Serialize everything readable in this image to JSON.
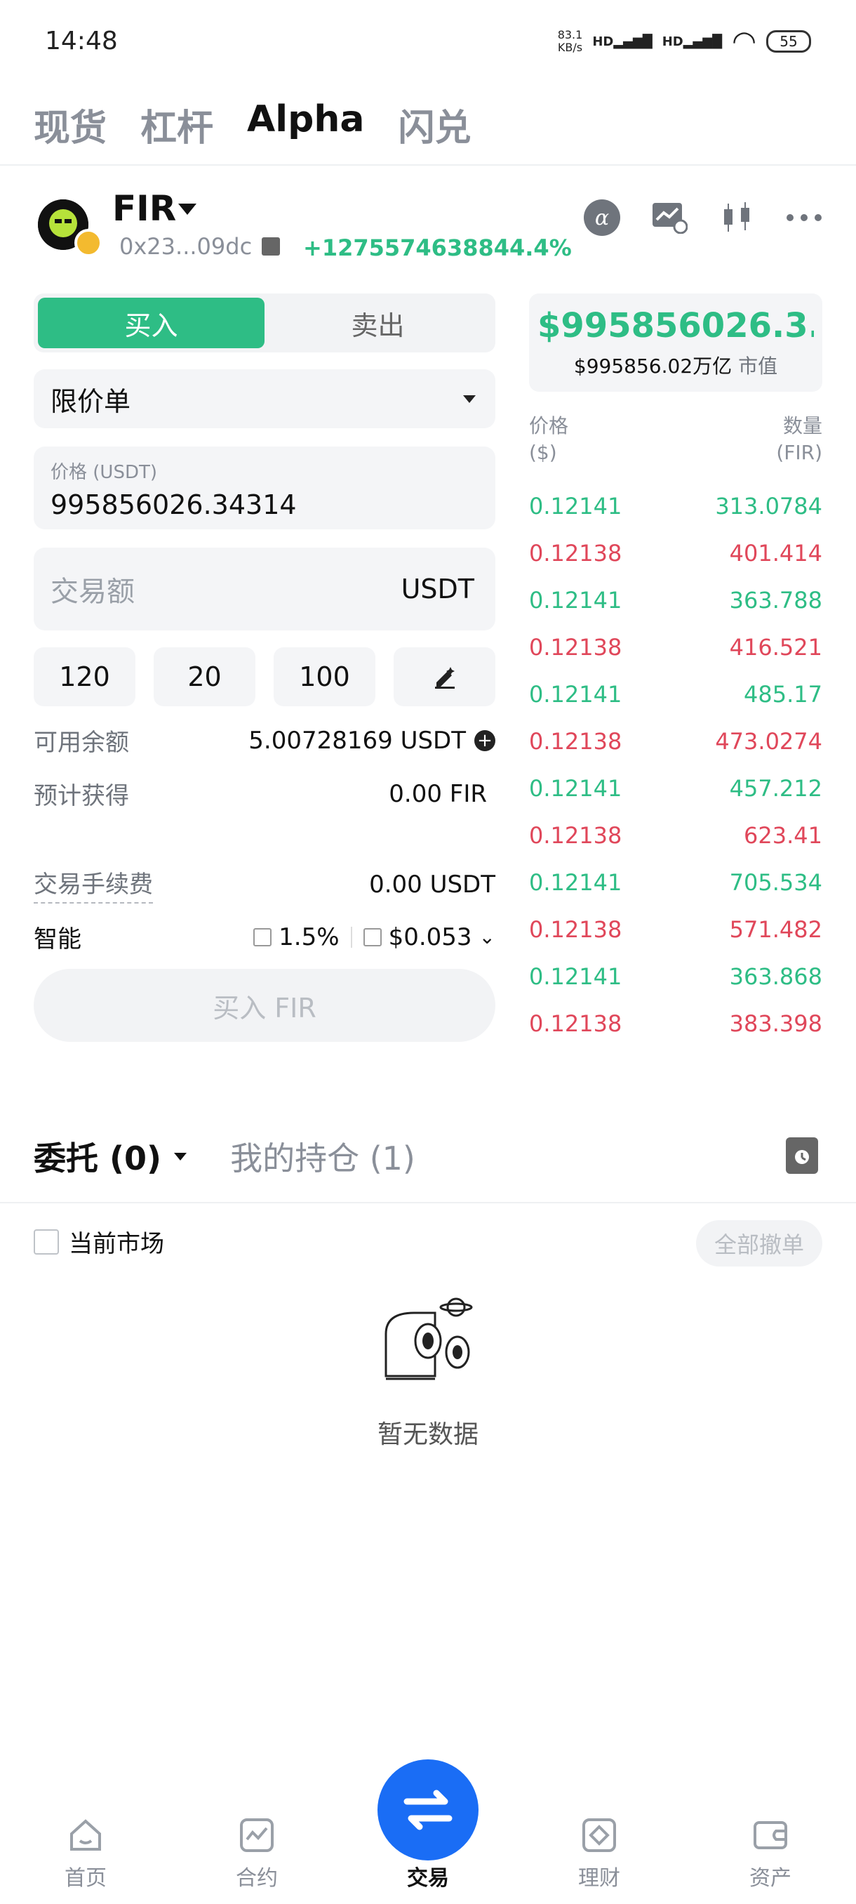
{
  "status_bar": {
    "time": "14:48",
    "net_speed_value": "83.1",
    "net_speed_unit": "KB/s",
    "signal_1": "HD",
    "signal_2": "HD",
    "battery": "55"
  },
  "top_tabs": [
    "现货",
    "杠杆",
    "Alpha",
    "闪兑"
  ],
  "active_top_tab": "Alpha",
  "token": {
    "name": "FIR",
    "address": "0x23...09dc",
    "change": "+1275574638844.4%"
  },
  "header_icons": [
    "alpha-icon",
    "chart-check-icon",
    "candlestick-icon",
    "more-icon"
  ],
  "trade_form": {
    "buy_label": "买入",
    "sell_label": "卖出",
    "order_type": "限价单",
    "price_label": "价格 (USDT)",
    "price_value": "995856026.34314",
    "amount_placeholder": "交易额",
    "amount_unit": "USDT",
    "quick_amounts": [
      "120",
      "20",
      "100"
    ],
    "available_label": "可用余额",
    "available_value": "5.00728169 USDT",
    "estimate_label": "预计获得",
    "estimate_value": "0.00 FIR",
    "fee_label": "交易手续费",
    "fee_value": "0.00 USDT",
    "smart_label": "智能",
    "slippage": "1.5%",
    "gas": "$0.053",
    "submit_label": "买入 FIR"
  },
  "price_card": {
    "price": "$995856026.3...",
    "market_cap": "$995856.02万亿",
    "market_cap_label": "市值"
  },
  "order_book": {
    "col_price": "价格",
    "col_price_unit": "($)",
    "col_qty": "数量",
    "col_qty_unit": "(FIR)",
    "rows": [
      {
        "price": "0.12141",
        "qty": "313.0784",
        "side": "buy"
      },
      {
        "price": "0.12138",
        "qty": "401.414",
        "side": "sell"
      },
      {
        "price": "0.12141",
        "qty": "363.788",
        "side": "buy"
      },
      {
        "price": "0.12138",
        "qty": "416.521",
        "side": "sell"
      },
      {
        "price": "0.12141",
        "qty": "485.17",
        "side": "buy"
      },
      {
        "price": "0.12138",
        "qty": "473.0274",
        "side": "sell"
      },
      {
        "price": "0.12141",
        "qty": "457.212",
        "side": "buy"
      },
      {
        "price": "0.12138",
        "qty": "623.41",
        "side": "sell"
      },
      {
        "price": "0.12141",
        "qty": "705.534",
        "side": "buy"
      },
      {
        "price": "0.12138",
        "qty": "571.482",
        "side": "sell"
      },
      {
        "price": "0.12141",
        "qty": "363.868",
        "side": "buy"
      },
      {
        "price": "0.12138",
        "qty": "383.398",
        "side": "sell"
      }
    ]
  },
  "orders": {
    "tab_open": "委托 (0)",
    "tab_positions": "我的持仓 (1)",
    "current_market_label": "当前市场",
    "cancel_all_label": "全部撤单",
    "empty_text": "暂无数据"
  },
  "bottom_nav": [
    "首页",
    "合约",
    "交易",
    "理财",
    "资产"
  ],
  "colors": {
    "buy_green": "#2ebd85",
    "sell_red": "#e0475a",
    "fab_blue": "#1a6df5"
  }
}
